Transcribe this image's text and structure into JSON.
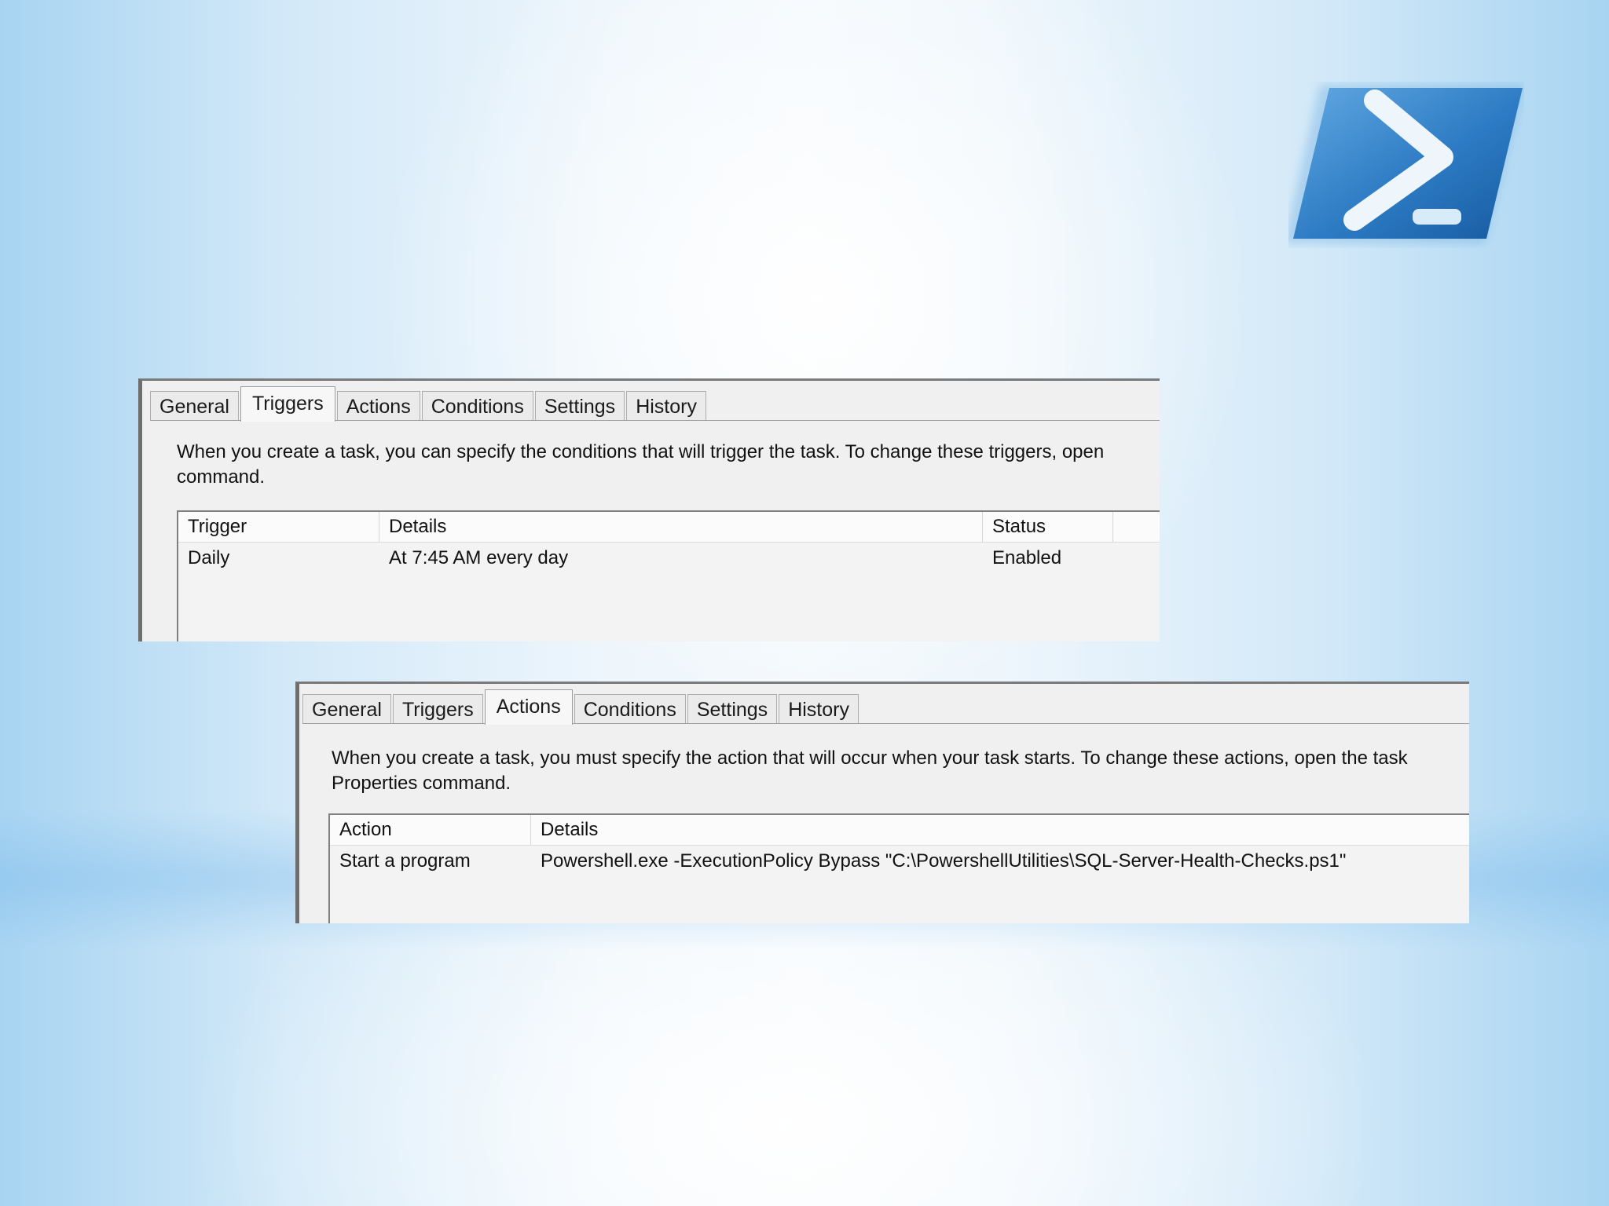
{
  "logo": {
    "name": "powershell-logo",
    "colors": {
      "primary": "#2d7bc4",
      "dark": "#165aa0",
      "light": "#62a9e2"
    }
  },
  "triggers_panel": {
    "tabs": [
      {
        "label": "General"
      },
      {
        "label": "Triggers",
        "active": true
      },
      {
        "label": "Actions"
      },
      {
        "label": "Conditions"
      },
      {
        "label": "Settings"
      },
      {
        "label": "History"
      }
    ],
    "description_line1": "When you create a task, you can specify the conditions that will trigger the task.  To change these triggers, open",
    "description_line2": "command.",
    "columns": [
      "Trigger",
      "Details",
      "Status"
    ],
    "rows": [
      {
        "trigger": "Daily",
        "details": "At 7:45 AM every day",
        "status": "Enabled"
      }
    ]
  },
  "actions_panel": {
    "tabs": [
      {
        "label": "General"
      },
      {
        "label": "Triggers"
      },
      {
        "label": "Actions",
        "active": true
      },
      {
        "label": "Conditions"
      },
      {
        "label": "Settings"
      },
      {
        "label": "History"
      }
    ],
    "description_line1": "When you create a task, you must specify the action that will occur when your task starts.  To change these actions, open the task",
    "description_line2": "Properties command.",
    "columns": [
      "Action",
      "Details"
    ],
    "rows": [
      {
        "action": "Start a program",
        "details": "Powershell.exe -ExecutionPolicy Bypass \"C:\\PowershellUtilities\\SQL-Server-Health-Checks.ps1\""
      }
    ]
  }
}
